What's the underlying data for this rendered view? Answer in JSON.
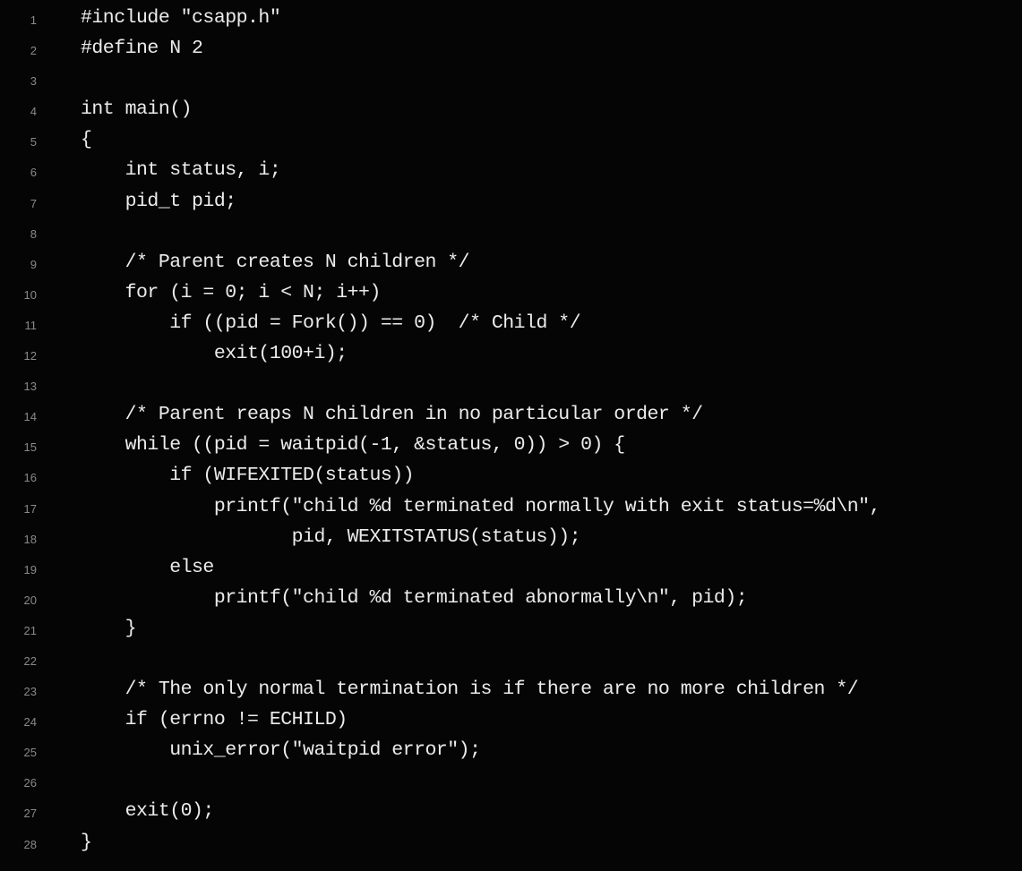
{
  "code_editor": {
    "lines": [
      {
        "number": "1",
        "text": "#include \"csapp.h\""
      },
      {
        "number": "2",
        "text": "#define N 2"
      },
      {
        "number": "3",
        "text": ""
      },
      {
        "number": "4",
        "text": "int main()"
      },
      {
        "number": "5",
        "text": "{"
      },
      {
        "number": "6",
        "text": "    int status, i;"
      },
      {
        "number": "7",
        "text": "    pid_t pid;"
      },
      {
        "number": "8",
        "text": ""
      },
      {
        "number": "9",
        "text": "    /* Parent creates N children */"
      },
      {
        "number": "10",
        "text": "    for (i = 0; i < N; i++)"
      },
      {
        "number": "11",
        "text": "        if ((pid = Fork()) == 0)  /* Child */"
      },
      {
        "number": "12",
        "text": "            exit(100+i);"
      },
      {
        "number": "13",
        "text": ""
      },
      {
        "number": "14",
        "text": "    /* Parent reaps N children in no particular order */"
      },
      {
        "number": "15",
        "text": "    while ((pid = waitpid(-1, &status, 0)) > 0) {"
      },
      {
        "number": "16",
        "text": "        if (WIFEXITED(status))"
      },
      {
        "number": "17",
        "text": "            printf(\"child %d terminated normally with exit status=%d\\n\","
      },
      {
        "number": "18",
        "text": "                   pid, WEXITSTATUS(status));"
      },
      {
        "number": "19",
        "text": "        else"
      },
      {
        "number": "20",
        "text": "            printf(\"child %d terminated abnormally\\n\", pid);"
      },
      {
        "number": "21",
        "text": "    }"
      },
      {
        "number": "22",
        "text": ""
      },
      {
        "number": "23",
        "text": "    /* The only normal termination is if there are no more children */"
      },
      {
        "number": "24",
        "text": "    if (errno != ECHILD)"
      },
      {
        "number": "25",
        "text": "        unix_error(\"waitpid error\");"
      },
      {
        "number": "26",
        "text": ""
      },
      {
        "number": "27",
        "text": "    exit(0);"
      },
      {
        "number": "28",
        "text": "}"
      }
    ]
  }
}
